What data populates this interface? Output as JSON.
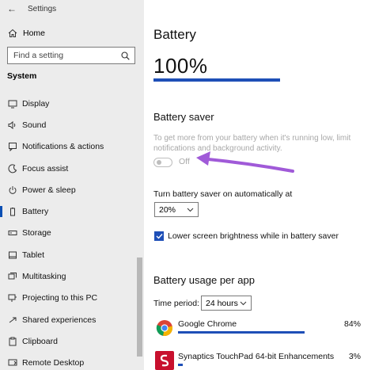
{
  "window": {
    "title": "Settings"
  },
  "sidebar": {
    "home_label": "Home",
    "search_placeholder": "Find a setting",
    "section": "System",
    "items": [
      {
        "label": "Display",
        "icon": "display-icon"
      },
      {
        "label": "Sound",
        "icon": "sound-icon"
      },
      {
        "label": "Notifications & actions",
        "icon": "notifications-icon"
      },
      {
        "label": "Focus assist",
        "icon": "focus-assist-icon"
      },
      {
        "label": "Power & sleep",
        "icon": "power-icon"
      },
      {
        "label": "Battery",
        "icon": "battery-icon",
        "active": true
      },
      {
        "label": "Storage",
        "icon": "storage-icon"
      },
      {
        "label": "Tablet",
        "icon": "tablet-icon"
      },
      {
        "label": "Multitasking",
        "icon": "multitasking-icon"
      },
      {
        "label": "Projecting to this PC",
        "icon": "projecting-icon"
      },
      {
        "label": "Shared experiences",
        "icon": "shared-icon"
      },
      {
        "label": "Clipboard",
        "icon": "clipboard-icon"
      },
      {
        "label": "Remote Desktop",
        "icon": "remote-desktop-icon"
      }
    ]
  },
  "main": {
    "title": "Battery",
    "battery_percent": "100%",
    "battery_level": 1.0,
    "saver": {
      "title": "Battery saver",
      "description": "To get more from your battery when it's running low, limit notifications and background activity.",
      "toggle_label": "Off",
      "auto_label": "Turn battery saver on automatically at",
      "auto_value": "20%",
      "brightness_label": "Lower screen brightness while in battery saver",
      "brightness_checked": true
    },
    "usage": {
      "title": "Battery usage per app",
      "period_label": "Time period:",
      "period_value": "24 hours",
      "apps": [
        {
          "name": "Google Chrome",
          "percent": "84%",
          "share": 0.84,
          "icon": "chrome-icon"
        },
        {
          "name": "Synaptics TouchPad 64-bit Enhancements",
          "percent": "3%",
          "share": 0.03,
          "icon": "synaptics-icon"
        }
      ]
    }
  },
  "colors": {
    "accent": "#1e4fb7",
    "sidebar_bg": "#ececec",
    "disabled_text": "#a8a8a8",
    "arrow": "#a05ad8"
  }
}
